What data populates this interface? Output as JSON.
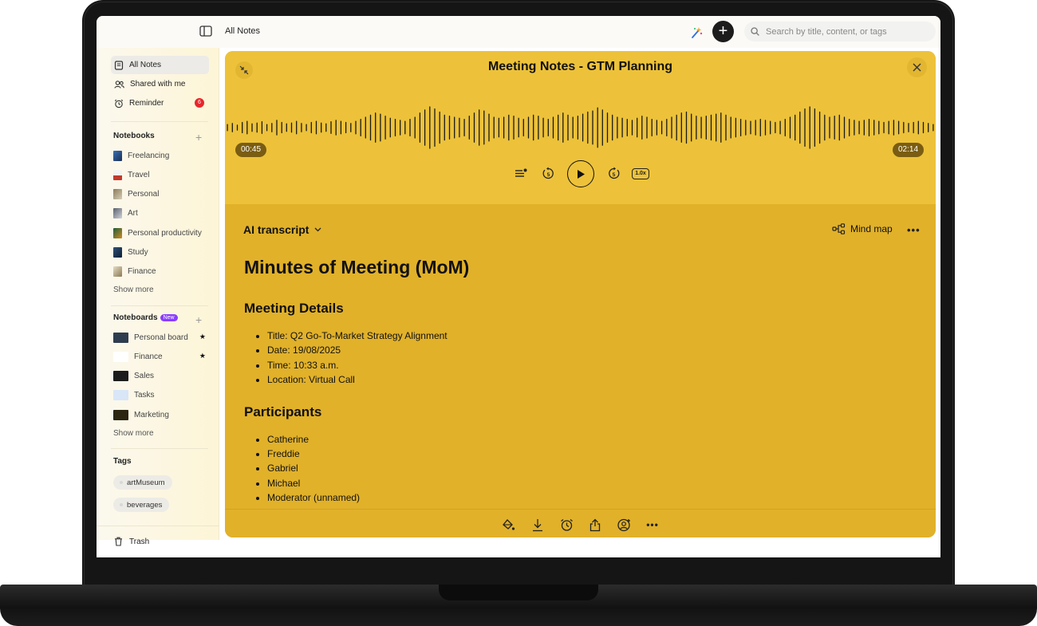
{
  "topbar": {
    "title": "All Notes",
    "search_placeholder": "Search by title, content, or tags",
    "add_label": "+"
  },
  "sidebar": {
    "nav": [
      {
        "label": "All Notes",
        "active": true
      },
      {
        "label": "Shared with me"
      },
      {
        "label": "Reminder",
        "badge": "6"
      }
    ],
    "notebooks_heading": "Notebooks",
    "notebooks": [
      {
        "label": "Freelancing",
        "color": "#3a6fb5"
      },
      {
        "label": "Travel",
        "color": "#c0392b"
      },
      {
        "label": "Personal",
        "color": "#8c7b5a"
      },
      {
        "label": "Art",
        "color": "#5b5f6b"
      },
      {
        "label": "Personal productivity",
        "color": "#8a5a20"
      },
      {
        "label": "Study",
        "color": "#2f4f78"
      },
      {
        "label": "Finance",
        "color": "#b9a47a"
      }
    ],
    "notebooks_show_more": "Show more",
    "noteboards_heading": "Noteboards",
    "noteboards_new": "New",
    "noteboards": [
      {
        "label": "Personal board",
        "color": "#2e3c4f",
        "starred": true
      },
      {
        "label": "Finance",
        "color": "#ffffff",
        "starred": true
      },
      {
        "label": "Sales",
        "color": "#1c1c1c"
      },
      {
        "label": "Tasks",
        "color": "#d8e6f7"
      },
      {
        "label": "Marketing",
        "color": "#2a2410"
      }
    ],
    "noteboards_show_more": "Show more",
    "tags_heading": "Tags",
    "tags": [
      "artMuseum",
      "beverages"
    ],
    "trash_label": "Trash",
    "star_glyph": "★"
  },
  "note": {
    "title": "Meeting Notes - GTM Planning",
    "current_time": "00:45",
    "total_time": "02:14",
    "skip_back_label": "5",
    "skip_forward_label": "5",
    "speed": "1.0x",
    "transcript_label": "AI transcript",
    "mindmap_label": "Mind map",
    "more_label": "•••",
    "colors": {
      "player": "#edc23a",
      "body": "#e1b12a",
      "time_chip": "#7a5d12"
    },
    "doc": {
      "h1": "Minutes of Meeting (MoM)",
      "details_heading": "Meeting Details",
      "details": [
        "Title: Q2 Go-To-Market Strategy Alignment",
        "Date: 19/08/2025",
        "Time: 10:33 a.m.",
        "Location: Virtual Call"
      ],
      "participants_heading": "Participants",
      "participants": [
        "Catherine",
        "Freddie",
        "Gabriel",
        "Michael",
        "Moderator (unnamed)"
      ]
    }
  },
  "waveform": {
    "levels": [
      0.15,
      0.2,
      0.12,
      0.25,
      0.3,
      0.18,
      0.22,
      0.28,
      0.15,
      0.2,
      0.35,
      0.25,
      0.18,
      0.22,
      0.3,
      0.2,
      0.15,
      0.25,
      0.3,
      0.22,
      0.18,
      0.28,
      0.35,
      0.3,
      0.25,
      0.2,
      0.3,
      0.4,
      0.5,
      0.6,
      0.7,
      0.65,
      0.55,
      0.45,
      0.4,
      0.35,
      0.3,
      0.4,
      0.5,
      0.7,
      0.85,
      1.0,
      0.9,
      0.75,
      0.6,
      0.55,
      0.5,
      0.45,
      0.4,
      0.55,
      0.7,
      0.85,
      0.8,
      0.65,
      0.5,
      0.45,
      0.5,
      0.6,
      0.55,
      0.45,
      0.4,
      0.5,
      0.6,
      0.55,
      0.45,
      0.4,
      0.5,
      0.6,
      0.7,
      0.6,
      0.5,
      0.55,
      0.65,
      0.75,
      0.8,
      0.95,
      0.85,
      0.7,
      0.6,
      0.5,
      0.45,
      0.4,
      0.35,
      0.45,
      0.55,
      0.5,
      0.4,
      0.35,
      0.3,
      0.4,
      0.5,
      0.6,
      0.7,
      0.75,
      0.65,
      0.55,
      0.5,
      0.55,
      0.6,
      0.65,
      0.7,
      0.6,
      0.5,
      0.45,
      0.4,
      0.35,
      0.3,
      0.35,
      0.4,
      0.35,
      0.3,
      0.25,
      0.3,
      0.4,
      0.5,
      0.6,
      0.75,
      0.9,
      1.0,
      0.9,
      0.75,
      0.6,
      0.5,
      0.55,
      0.6,
      0.5,
      0.4,
      0.35,
      0.3,
      0.35,
      0.4,
      0.35,
      0.3,
      0.25,
      0.3,
      0.35,
      0.3,
      0.25,
      0.2,
      0.25,
      0.3,
      0.25,
      0.2,
      0.15
    ]
  }
}
